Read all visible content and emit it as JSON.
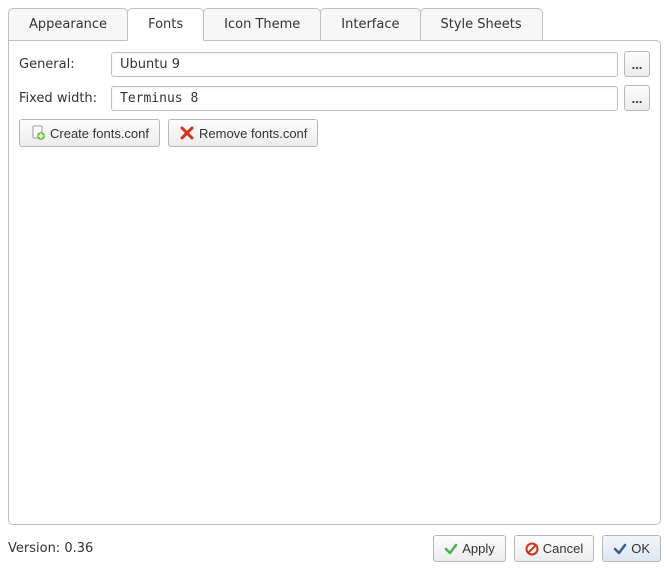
{
  "tabs": [
    {
      "label": "Appearance"
    },
    {
      "label": "Fonts"
    },
    {
      "label": "Icon Theme"
    },
    {
      "label": "Interface"
    },
    {
      "label": "Style Sheets"
    }
  ],
  "active_tab": 1,
  "fonts": {
    "general_label": "General:",
    "general_value": "Ubuntu 9",
    "fixed_label": "Fixed width:",
    "fixed_value": "Terminus 8",
    "browse_label": "...",
    "create_label": "Create fonts.conf",
    "remove_label": "Remove fonts.conf"
  },
  "footer": {
    "version": "Version: 0.36",
    "apply": "Apply",
    "cancel": "Cancel",
    "ok": "OK"
  }
}
